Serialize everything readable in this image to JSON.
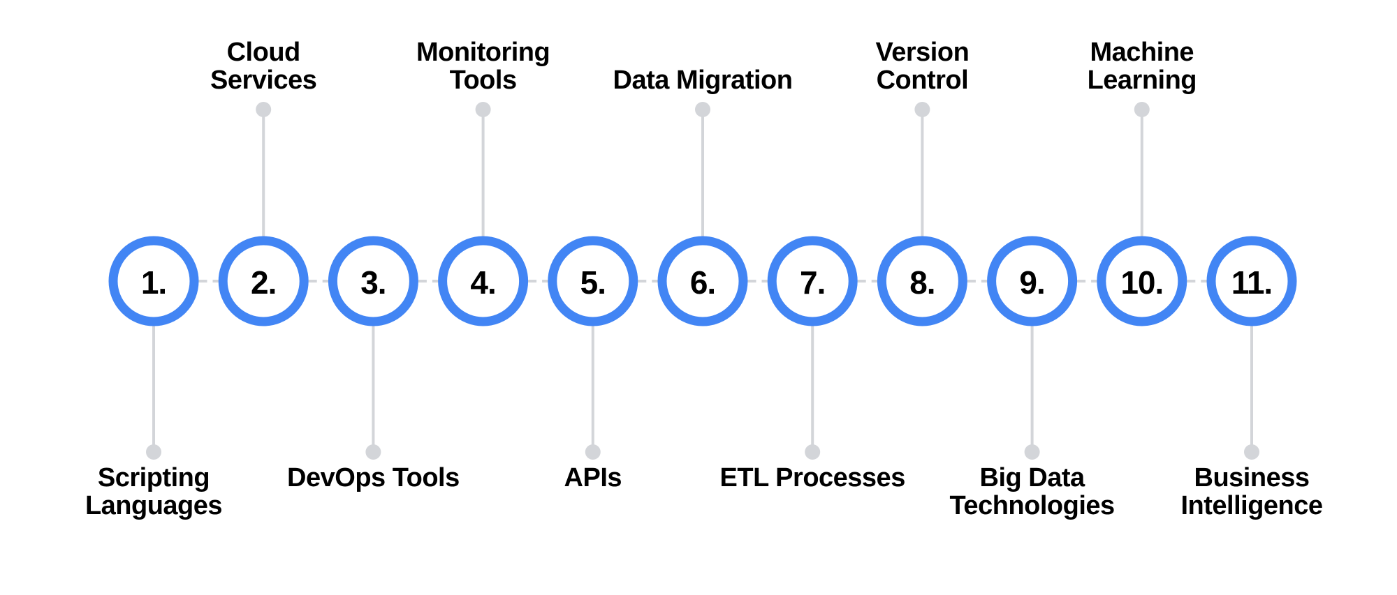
{
  "diagram": {
    "colors": {
      "ring": "#4285F4",
      "connector": "#D3D5D9",
      "text": "#000000",
      "background": "#FFFFFF"
    },
    "steps": [
      {
        "number": "1.",
        "label_lines": [
          "Scripting",
          "Languages"
        ],
        "label_side": "bottom"
      },
      {
        "number": "2.",
        "label_lines": [
          "Cloud",
          "Services"
        ],
        "label_side": "top"
      },
      {
        "number": "3.",
        "label_lines": [
          "DevOps Tools"
        ],
        "label_side": "bottom"
      },
      {
        "number": "4.",
        "label_lines": [
          "Monitoring",
          "Tools"
        ],
        "label_side": "top"
      },
      {
        "number": "5.",
        "label_lines": [
          "APIs"
        ],
        "label_side": "bottom"
      },
      {
        "number": "6.",
        "label_lines": [
          "Data Migration"
        ],
        "label_side": "top"
      },
      {
        "number": "7.",
        "label_lines": [
          "ETL Processes"
        ],
        "label_side": "bottom"
      },
      {
        "number": "8.",
        "label_lines": [
          "Version",
          "Control"
        ],
        "label_side": "top"
      },
      {
        "number": "9.",
        "label_lines": [
          "Big Data",
          "Technologies"
        ],
        "label_side": "bottom"
      },
      {
        "number": "10.",
        "label_lines": [
          "Machine",
          "Learning"
        ],
        "label_side": "top"
      },
      {
        "number": "11.",
        "label_lines": [
          "Business",
          "Intelligence"
        ],
        "label_side": "bottom"
      }
    ]
  }
}
